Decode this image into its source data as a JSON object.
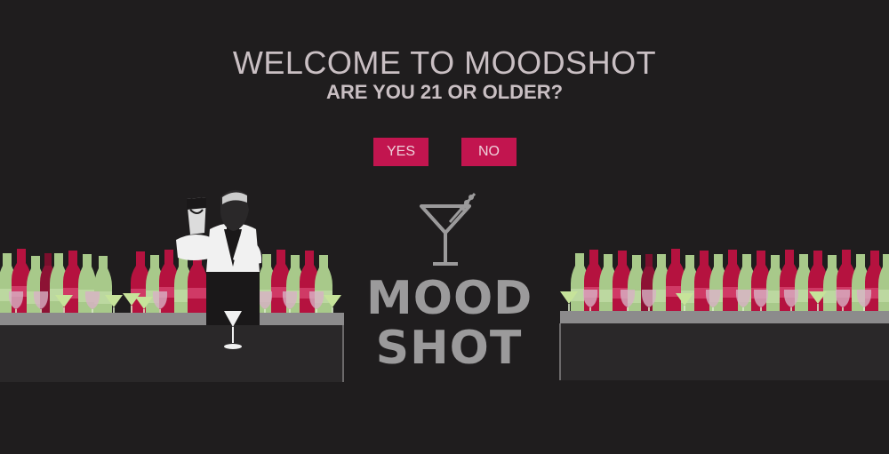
{
  "dialog": {
    "title": "WELCOME TO MOODSHOT",
    "question": "ARE YOU 21 OR OLDER?",
    "yes_label": "YES",
    "no_label": "NO"
  },
  "logo": {
    "line1": "MOOD",
    "line2": "SHOT"
  },
  "colors": {
    "background": "#1f1d1e",
    "accent": "#c2154f",
    "heading_text": "#c9bfc3",
    "logo_gray": "#9b9a9b"
  },
  "icons": [
    "martini-glass-icon",
    "bartender-illustration",
    "bottle-shelf-illustration"
  ]
}
